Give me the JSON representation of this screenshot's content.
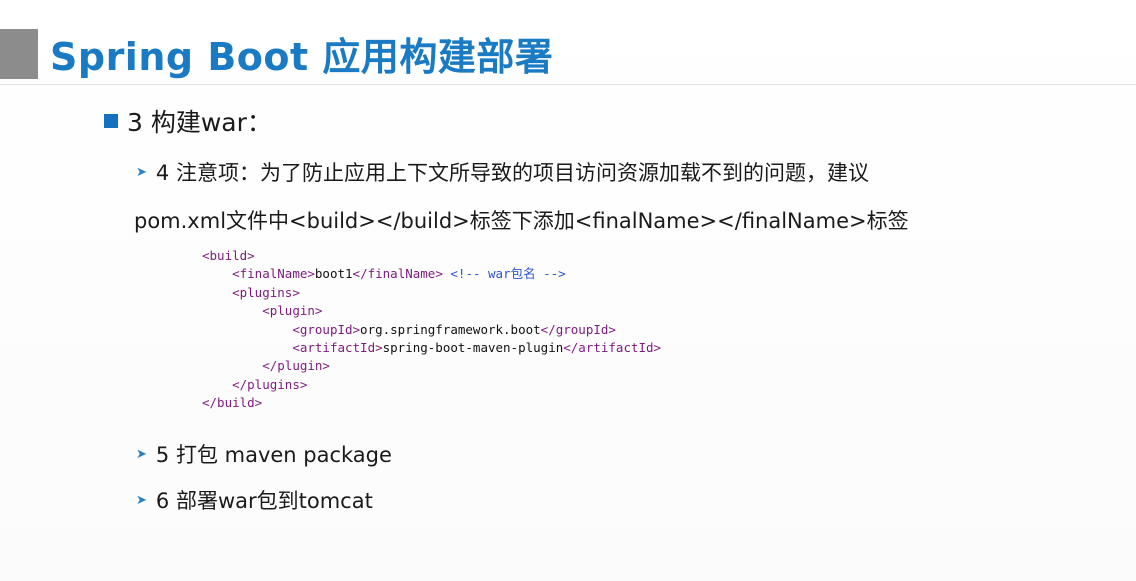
{
  "slide": {
    "title": "Spring Boot 应用构建部署",
    "heading": "3 构建war：",
    "items": [
      {
        "text": "4 注意项：为了防止应用上下文所导致的项目访问资源加载不到的问题，建议"
      },
      {
        "text": "5 打包 maven package"
      },
      {
        "text": "6 部署war包到tomcat"
      }
    ],
    "continuation": "pom.xml文件中<build></build>标签下添加<finalName></finalName>标签",
    "code": {
      "l1": "<build>",
      "l2_open": "<finalName>",
      "l2_val": "boot1",
      "l2_close": "</finalName>",
      "l2_comment": "<!-- war包名 -->",
      "l3": "<plugins>",
      "l4": "<plugin>",
      "l5_open": "<groupId>",
      "l5_val": "org.springframework.boot",
      "l5_close": "</groupId>",
      "l6_open": "<artifactId>",
      "l6_val": "spring-boot-maven-plugin",
      "l6_close": "</artifactId>",
      "l7": "</plugin>",
      "l8": "</plugins>",
      "l9": "</build>"
    }
  },
  "colors": {
    "title": "#1a7ac3",
    "bullet": "#1570c0",
    "arrow": "#2d7fc4",
    "tag": "#7d1a7d",
    "comment": "#2b55c8"
  }
}
